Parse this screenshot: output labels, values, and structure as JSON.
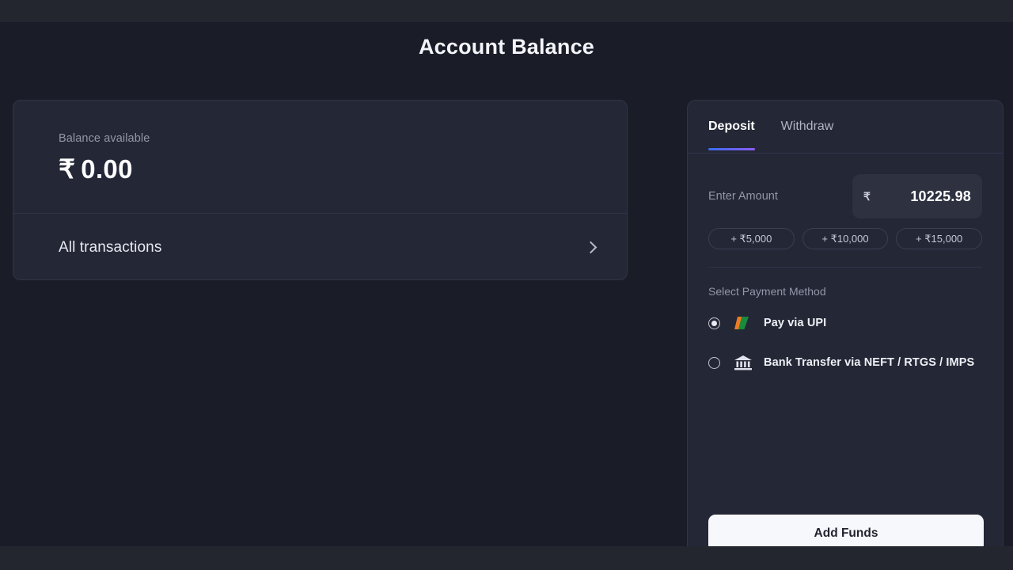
{
  "page": {
    "title": "Account Balance"
  },
  "balance_card": {
    "label": "Balance available",
    "rupee_symbol": "₹",
    "amount": "0.00",
    "transactions_link": "All transactions",
    "chevron_icon": "chevron-right-icon"
  },
  "deposit_panel": {
    "tabs": [
      {
        "label": "Deposit",
        "active": true
      },
      {
        "label": "Withdraw",
        "active": false
      }
    ],
    "amount": {
      "label": "Enter Amount",
      "currency_symbol": "₹",
      "value": "10225.98",
      "placeholder": "0"
    },
    "quick_amounts": [
      {
        "label": "+ ₹5,000"
      },
      {
        "label": "+ ₹10,000"
      },
      {
        "label": "+ ₹15,000"
      }
    ],
    "payment_section_label": "Select Payment Method",
    "payment_methods": [
      {
        "label": "Pay via UPI",
        "icon": "upi-logo-icon",
        "selected": true
      },
      {
        "label": "Bank Transfer via NEFT / RTGS / IMPS",
        "icon": "bank-building-icon",
        "selected": false
      }
    ],
    "submit_label": "Add Funds"
  },
  "colors": {
    "background": "#1a1c27",
    "chrome_bar": "#24262f",
    "card": "#242735",
    "card_border": "#31344a",
    "input": "#2e3140",
    "text_primary": "#ffffff",
    "text_muted": "#9296a8",
    "tab_indicator_from": "#3a6df0",
    "tab_indicator_to": "#8b5cf6",
    "button_bg": "#f7f8fb",
    "button_text": "#21242f",
    "upi_orange": "#ef7a21",
    "upi_green": "#1a8a3c"
  }
}
